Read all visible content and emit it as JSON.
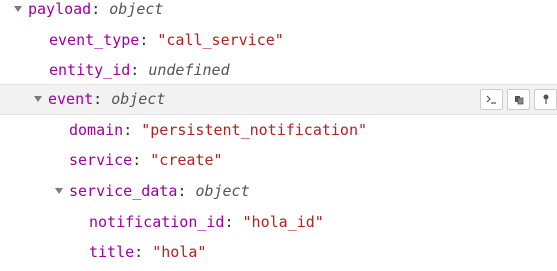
{
  "tree": {
    "payload": {
      "key": "payload",
      "type": "object"
    },
    "event_type": {
      "key": "event_type",
      "value": "\"call_service\""
    },
    "entity_id": {
      "key": "entity_id",
      "value": "undefined"
    },
    "event": {
      "key": "event",
      "type": "object"
    },
    "domain": {
      "key": "domain",
      "value": "\"persistent_notification\""
    },
    "service": {
      "key": "service",
      "value": "\"create\""
    },
    "service_data": {
      "key": "service_data",
      "type": "object"
    },
    "notification_id": {
      "key": "notification_id",
      "value": "\"hola_id\""
    },
    "title": {
      "key": "title",
      "value": "\"hola\""
    }
  },
  "actions": {
    "copy_path_icon": "terminal-icon",
    "copy_value_icon": "copy-icon",
    "pin_icon": "pin-icon"
  }
}
